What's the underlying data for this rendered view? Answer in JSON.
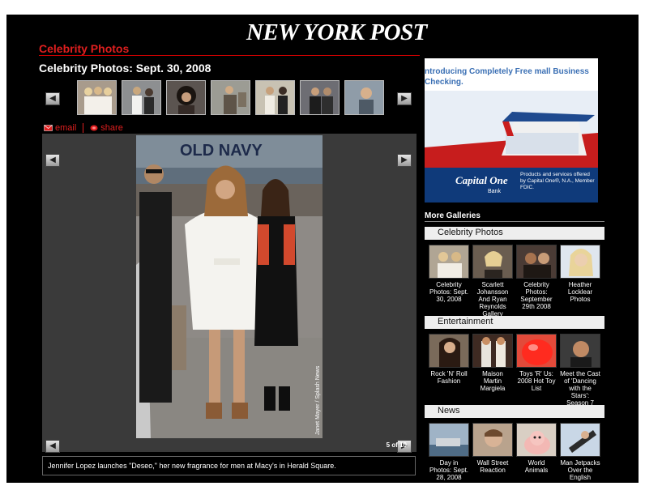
{
  "masthead": "NEW YORK POST",
  "section_title": "Celebrity Photos",
  "gallery_title": "Celebrity Photos: Sept. 30, 2008",
  "actions": {
    "email": "email",
    "share": "share"
  },
  "viewer": {
    "counter": "5 of 10",
    "photo_storefront": "OLD NAVY",
    "photo_credit": "Janet Mayer / Splash News"
  },
  "caption": "Jennifer Lopez launches \"Deseo,\" her new fragrance for men at Macy's in Herald Square.",
  "ad": {
    "headline": "ntroducing Completely Free mall Business Checking.",
    "bank_name": "Capital One",
    "bank_sub": "Bank",
    "fine_print": "Products and services offered by Capital One®, N.A., Member FDIC."
  },
  "more_galleries": {
    "title": "More Galleries",
    "sections": [
      {
        "name": "Celebrity Photos",
        "items": [
          "Celebrity Photos: Sept. 30, 2008",
          "Scarlett Johansson And Ryan Reynolds Gallery",
          "Celebrity Photos: September 29th 2008",
          "Heather Locklear Photos"
        ]
      },
      {
        "name": "Entertainment",
        "items": [
          "Rock 'N' Roll Fashion",
          "Maison Martin Margiela",
          "Toys 'R' Us: 2008 Hot Toy List",
          "Meet the Cast of 'Dancing with the Stars': Season 7"
        ]
      },
      {
        "name": "News",
        "items": [
          "Day in Photos: Sept. 28, 2008",
          "Wall Street Reaction",
          "World Animals",
          "Man Jetpacks Over the English"
        ]
      }
    ]
  },
  "colors": {
    "accent": "#e01f1f",
    "background": "#000000",
    "viewer": "#3a3a3a",
    "ad_blue": "#3a6fb4"
  }
}
